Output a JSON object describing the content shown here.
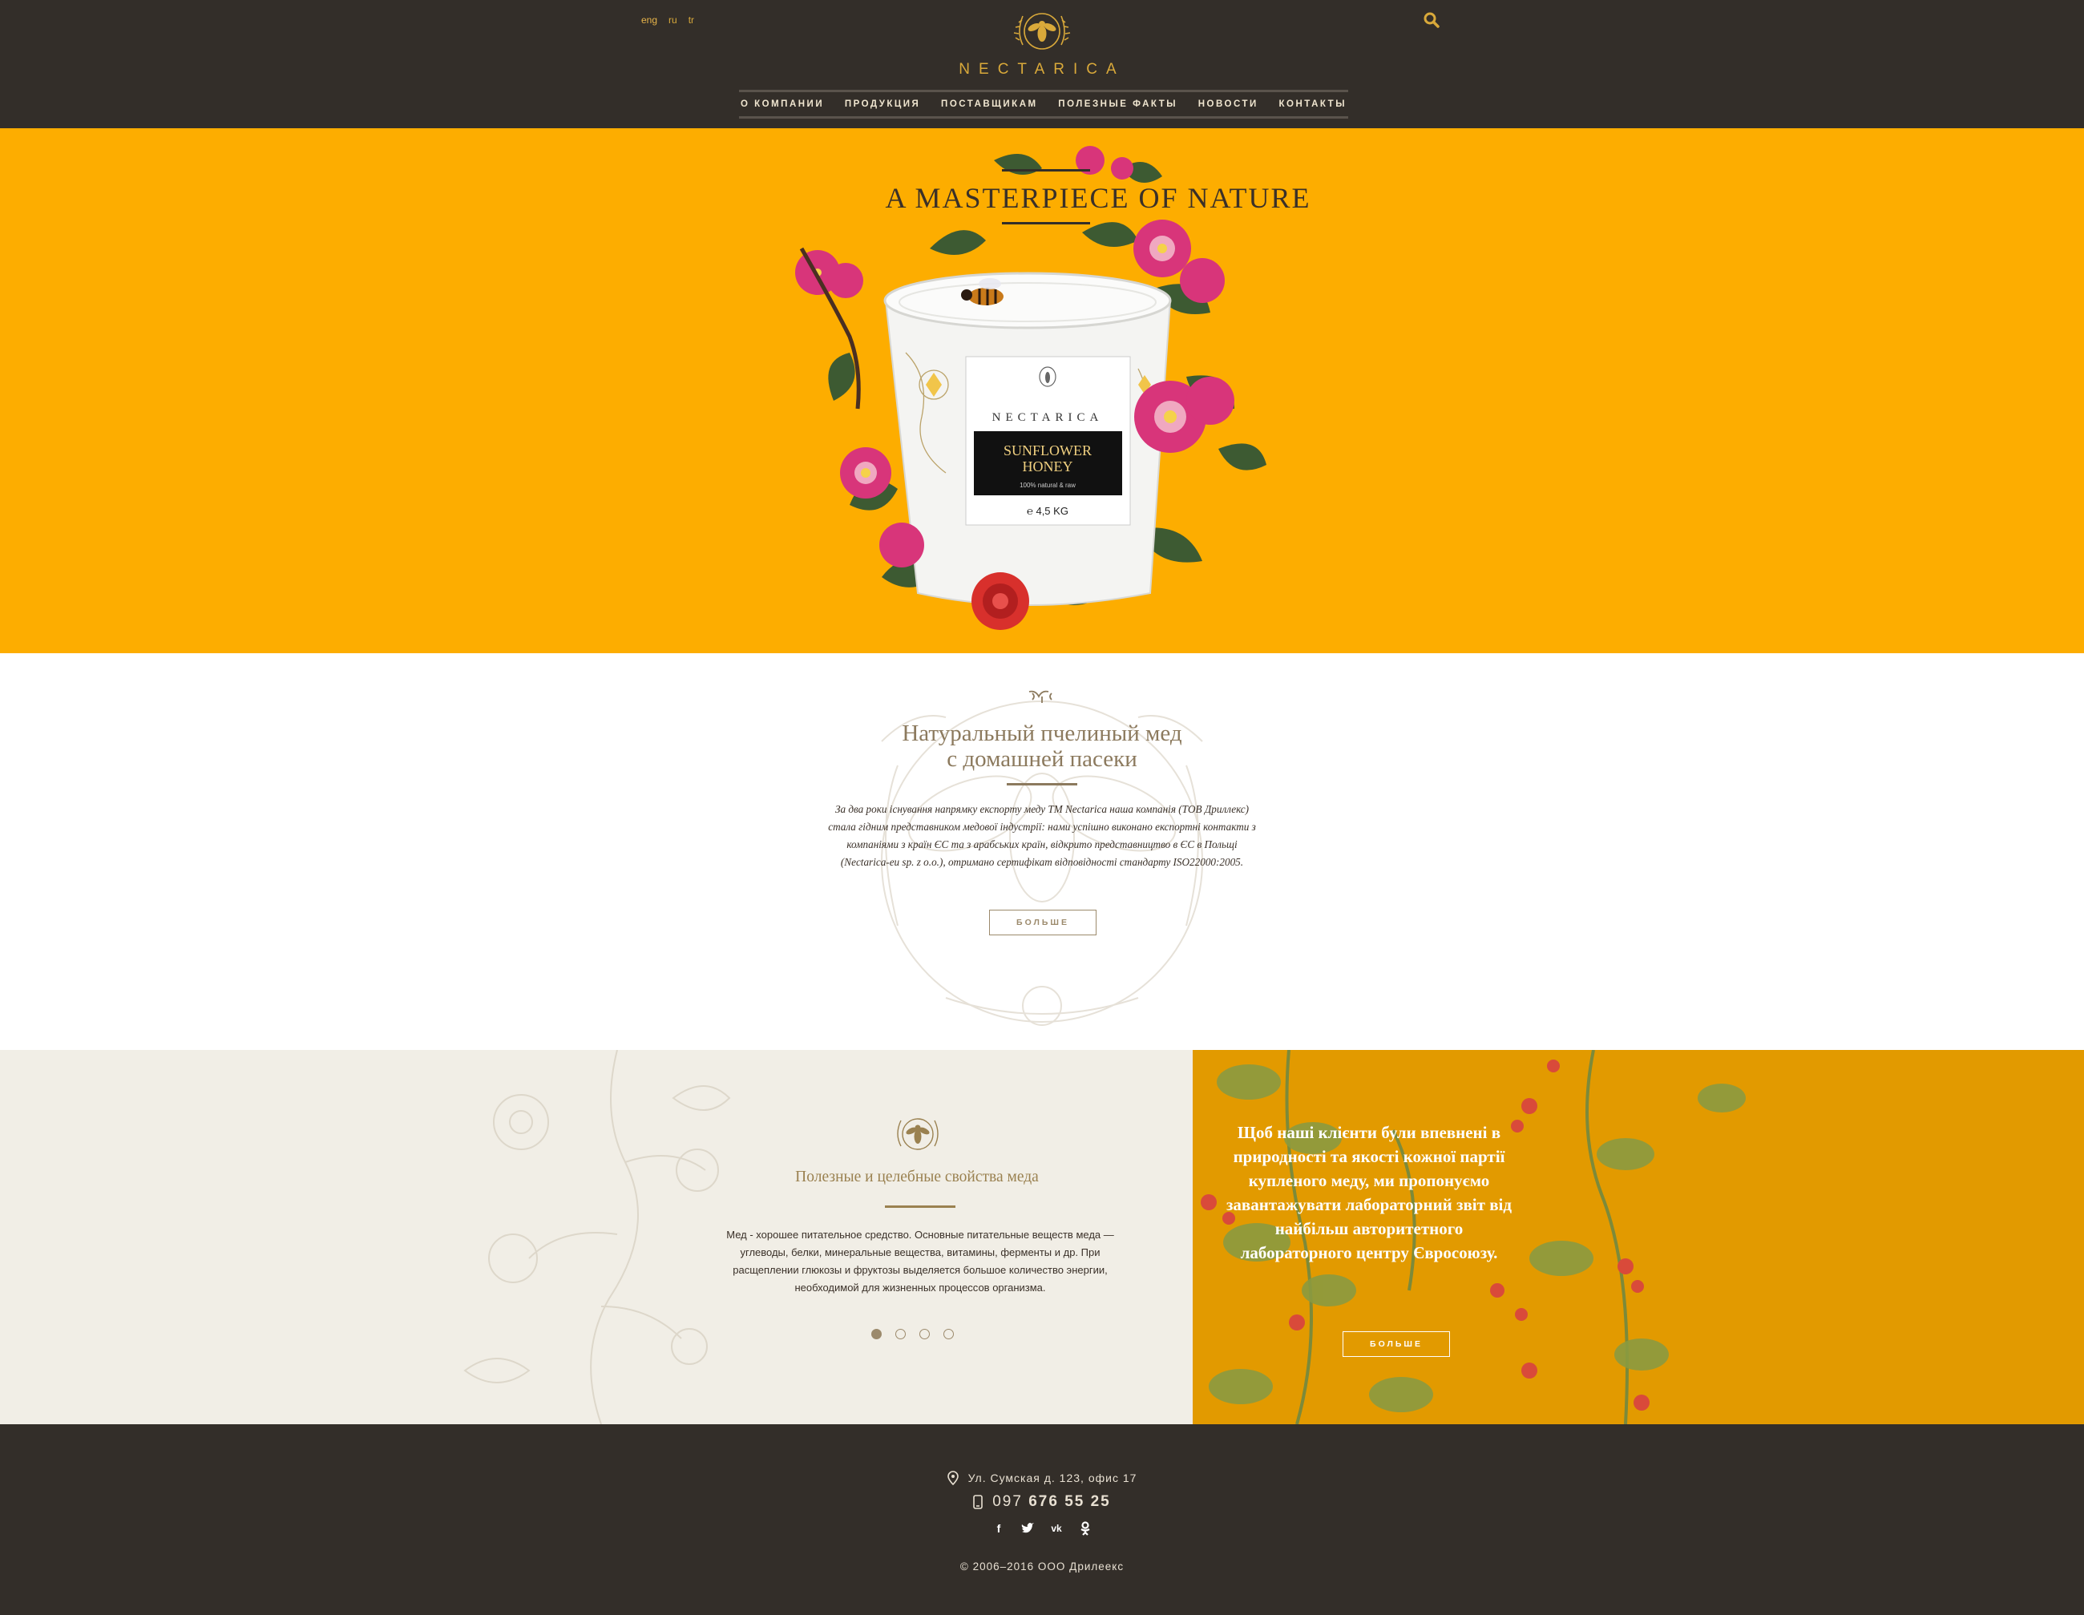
{
  "header": {
    "languages": [
      "eng",
      "ru",
      "tr"
    ],
    "brand": "NECTARICA",
    "nav": [
      "О КОМПАНИИ",
      "ПРОДУКЦИЯ",
      "ПОСТАВЩИКАМ",
      "ПОЛЕЗНЫЕ ФАКТЫ",
      "НОВОСТИ",
      "КОНТАКТЫ"
    ]
  },
  "hero": {
    "title": "A MASTERPIECE OF NATURE",
    "product": {
      "brand": "NECTARICA",
      "name_line1": "SUNFLOWER",
      "name_line2": "HONEY",
      "subtitle": "100% natural & raw",
      "weight": "℮ 4,5 KG"
    }
  },
  "about": {
    "title_line1": "Натуральный пчелиный мед",
    "title_line2": "с домашней пасеки",
    "text": "За два роки існування напрямку експорту меду ТМ Nectarica наша компанія (ТОВ Дриллекс) стала гідним представником медової індустрії: нами успішно виконано експортні контакти з компаніями з країн ЄС та з арабських країн, відкрито представництво в ЄС в Польщі (Nectarica-eu sp. z o.o.), отримано сертифікат відповідності стандарту ISO22000:2005.",
    "button": "БОЛЬШЕ"
  },
  "facts": {
    "title": "Полезные и целебные свойства меда",
    "text": "Мед - хорошее питательное средство. Основные питательные веществ меда — углеводы, белки, минеральные вещества, витамины, ферменты и др. При расщеплении глюкозы и фруктозы выделяется большое количество энергии, необходимой для жизненных процессов организма.",
    "slide_count": 4,
    "active_slide": 1
  },
  "lab": {
    "text": "Щоб наші клієнти були впевнені в природності та якості кожної партії купленого меду, ми пропонуємо завантажувати лабораторний звіт від найбільш авторитетного лабораторного центру Євросоюзу.",
    "button": "БОЛЬШЕ"
  },
  "footer": {
    "address": "Ул. Сумская д. 123, офис 17",
    "phone_prefix": "097",
    "phone_number": "676 55 25",
    "social": [
      "facebook",
      "twitter",
      "vk",
      "odnoklassniki"
    ],
    "copyright": "© 2006–2016 ООО Дрилеекс"
  },
  "colors": {
    "header_bg": "#332e29",
    "gold": "#d9a93a",
    "hero_bg": "#fdad00",
    "lab_bg": "#e29a00",
    "cream": "#f1eee6",
    "brown_text": "#8c7a5e"
  }
}
